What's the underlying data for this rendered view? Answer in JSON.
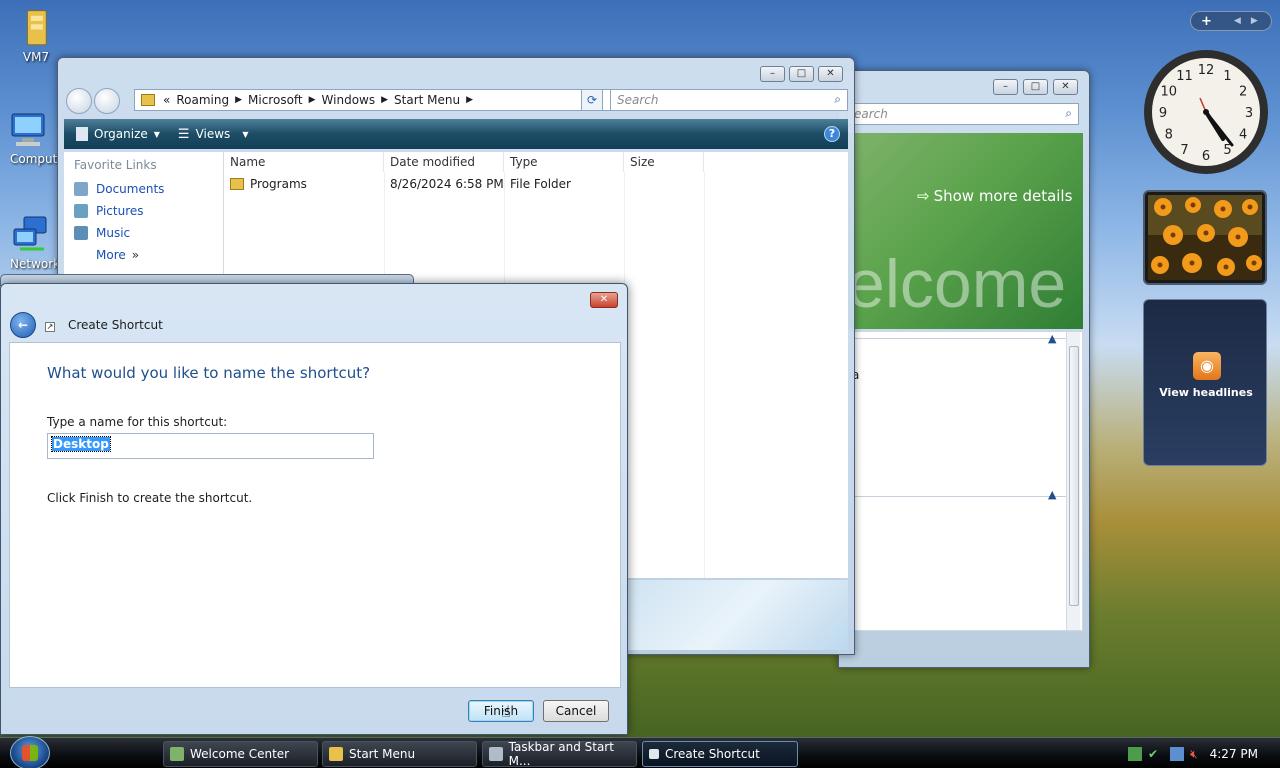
{
  "desktop": {
    "icons": [
      {
        "label": "VM7",
        "icon": "folder-icon"
      },
      {
        "label": "Comput",
        "icon": "computer-icon"
      },
      {
        "label": "Network",
        "icon": "network-icon"
      }
    ]
  },
  "explorer": {
    "breadcrumb_prefix": "«",
    "breadcrumb": [
      "Roaming",
      "Microsoft",
      "Windows",
      "Start Menu"
    ],
    "search_placeholder": "Search",
    "toolbar": {
      "organize": "Organize",
      "views": "Views"
    },
    "nav": {
      "header": "Favorite Links",
      "items": [
        "Documents",
        "Pictures",
        "Music"
      ],
      "more": "More"
    },
    "columns": [
      "Name",
      "Date modified",
      "Type",
      "Size"
    ],
    "files": [
      {
        "name": "Programs",
        "date": "8/26/2024 6:58 PM",
        "type": "File Folder",
        "size": ""
      }
    ]
  },
  "welcome_center": {
    "search_placeholder": "earch",
    "show_more": "Show more details",
    "banner_text": "elcome",
    "fragment": "a"
  },
  "dialog": {
    "title": "Create Shortcut",
    "heading": "What would you like to name the shortcut?",
    "field_label": "Type a name for this shortcut:",
    "field_value": "Desktop",
    "instruction": "Click Finish to create the shortcut.",
    "finish_label": "Finish",
    "cancel_label": "Cancel"
  },
  "sidebar": {
    "add_label": "+",
    "rss_label": "View headlines",
    "clock_numbers": [
      "12",
      "1",
      "2",
      "3",
      "4",
      "5",
      "6",
      "7",
      "8",
      "9",
      "10",
      "11"
    ]
  },
  "taskbar": {
    "items": [
      {
        "label": "Welcome Center",
        "active": false
      },
      {
        "label": "Start Menu",
        "active": false
      },
      {
        "label": "Taskbar and Start M...",
        "active": false
      },
      {
        "label": "Create Shortcut",
        "active": true
      }
    ],
    "time": "4:27 PM"
  },
  "colors": {
    "accent": "#1a4fb3",
    "heading": "#1f4f8f",
    "selection": "#3399ff"
  }
}
